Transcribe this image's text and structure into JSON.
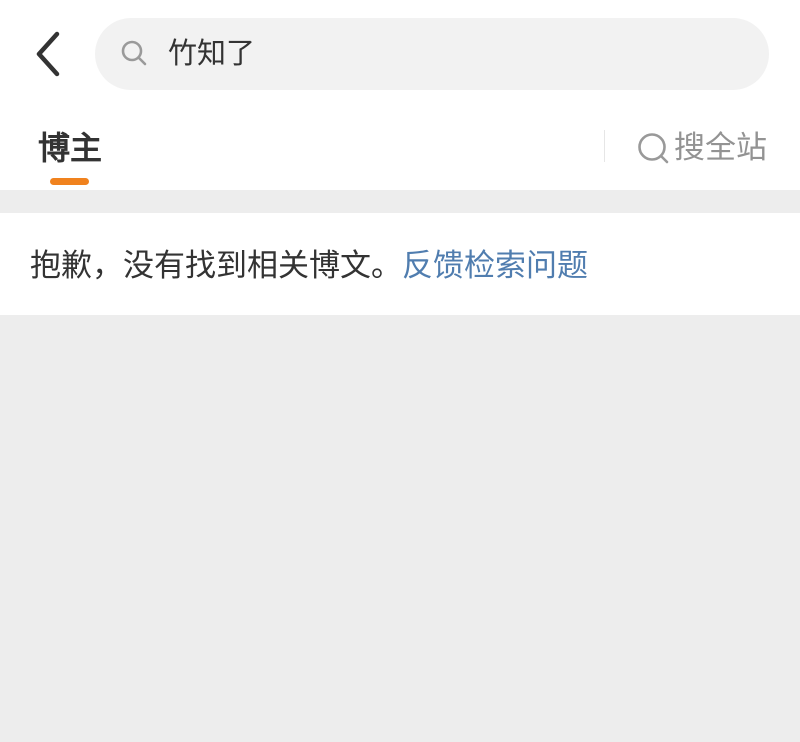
{
  "header": {
    "back_icon": "chevron-left-icon",
    "search": {
      "icon": "search-icon",
      "query": "竹知了"
    }
  },
  "tabs": {
    "active": {
      "label": "博主",
      "indicator_color": "#f0821e"
    },
    "search_all": {
      "icon": "search-icon",
      "label": "搜全站"
    }
  },
  "result": {
    "message": "抱歉，没有找到相关博文。",
    "feedback_link": "反馈检索问题",
    "link_color": "#507daf"
  },
  "colors": {
    "background": "#ededed",
    "surface": "#ffffff",
    "search_box": "#f2f2f2",
    "primary_text": "#333333",
    "muted_text": "#939393"
  }
}
